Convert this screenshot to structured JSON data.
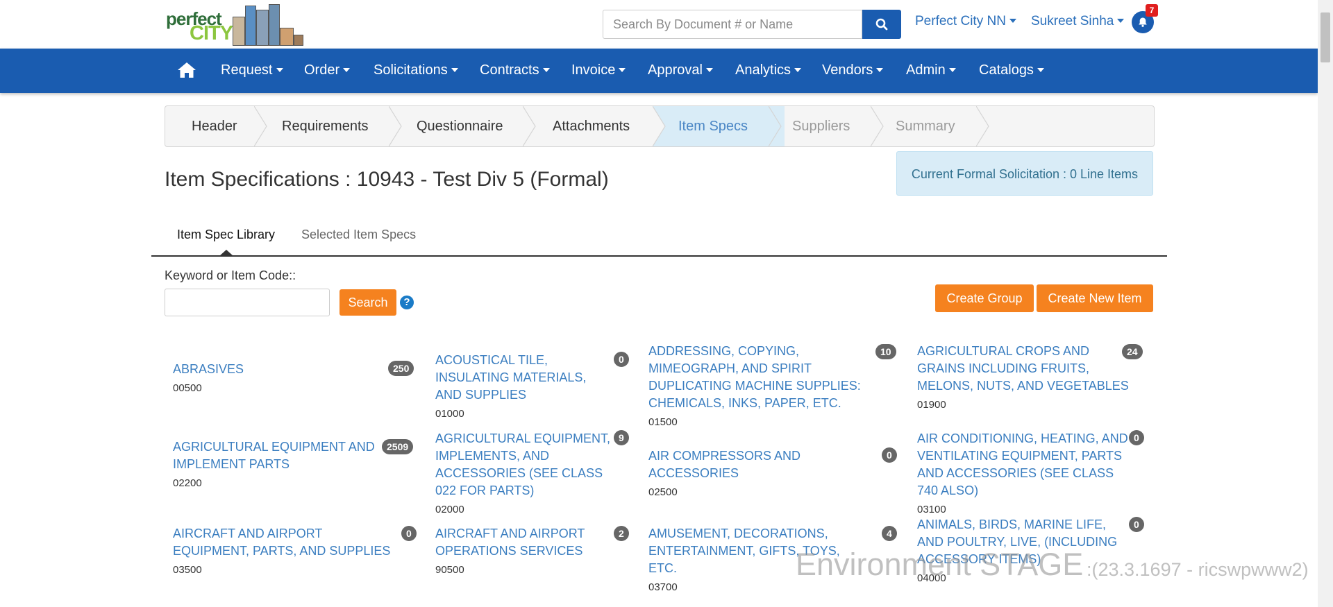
{
  "logo": {
    "line1": "perfect",
    "line2": "CITY"
  },
  "search": {
    "placeholder": "Search By Document # or Name"
  },
  "topnav": {
    "org": "Perfect City NN",
    "user": "Sukreet Sinha",
    "notifications": "7"
  },
  "navbar": [
    "Request",
    "Order",
    "Solicitations",
    "Contracts",
    "Invoice",
    "Approval",
    "Analytics",
    "Vendors",
    "Admin",
    "Catalogs"
  ],
  "wizard": {
    "steps": [
      "Header",
      "Requirements",
      "Questionnaire",
      "Attachments",
      "Item Specs",
      "Suppliers",
      "Summary"
    ],
    "active": "Item Specs"
  },
  "page": {
    "title": "Item Specifications : 10943 - Test Div 5 (Formal)",
    "info": "Current Formal Solicitation : 0 Line Items"
  },
  "tabs": [
    "Item Spec Library",
    "Selected Item Specs"
  ],
  "filter": {
    "keyword_label": "Keyword or Item Code::",
    "search_button": "Search",
    "help": "?",
    "create_group": "Create Group",
    "create_new_item": "Create New Item"
  },
  "categories": [
    {
      "name": "ABRASIVES",
      "code": "00500",
      "count": "250"
    },
    {
      "name": "ACOUSTICAL TILE, INSULATING MATERIALS, AND SUPPLIES",
      "code": "01000",
      "count": "0"
    },
    {
      "name": "ADDRESSING, COPYING, MIMEOGRAPH, AND SPIRIT DUPLICATING MACHINE SUPPLIES: CHEMICALS, INKS, PAPER, ETC.",
      "code": "01500",
      "count": "10"
    },
    {
      "name": "AGRICULTURAL CROPS AND GRAINS INCLUDING FRUITS, MELONS, NUTS, AND VEGETABLES",
      "code": "01900",
      "count": "24"
    },
    {
      "name": "AGRICULTURAL EQUIPMENT AND IMPLEMENT PARTS",
      "code": "02200",
      "count": "2509"
    },
    {
      "name": "AGRICULTURAL EQUIPMENT, IMPLEMENTS, AND ACCESSORIES (SEE CLASS 022 FOR PARTS)",
      "code": "02000",
      "count": "9"
    },
    {
      "name": "AIR COMPRESSORS AND ACCESSORIES",
      "code": "02500",
      "count": "0"
    },
    {
      "name": "AIR CONDITIONING, HEATING, AND VENTILATING EQUIPMENT, PARTS AND ACCESSORIES (SEE CLASS 740 ALSO)",
      "code": "03100",
      "count": "0"
    },
    {
      "name": "AIRCRAFT AND AIRPORT EQUIPMENT, PARTS, AND SUPPLIES",
      "code": "03500",
      "count": "0"
    },
    {
      "name": "AIRCRAFT AND AIRPORT OPERATIONS SERVICES",
      "code": "90500",
      "count": "2"
    },
    {
      "name": "AMUSEMENT, DECORATIONS, ENTERTAINMENT, GIFTS, TOYS, ETC.",
      "code": "03700",
      "count": "4"
    },
    {
      "name": "ANIMALS, BIRDS, MARINE LIFE, AND POULTRY, LIVE, (INCLUDING ACCESSORY ITEMS)",
      "code": "04000",
      "count": "0"
    }
  ],
  "environment": {
    "label": "Environment STAGE",
    "build": ":(23.3.1697 - ricswpwww2)"
  },
  "colors": {
    "nav": "#1a5cb0",
    "accent": "#f5821f",
    "link": "#3b7ec0",
    "info_bg": "#d9ecf7"
  }
}
